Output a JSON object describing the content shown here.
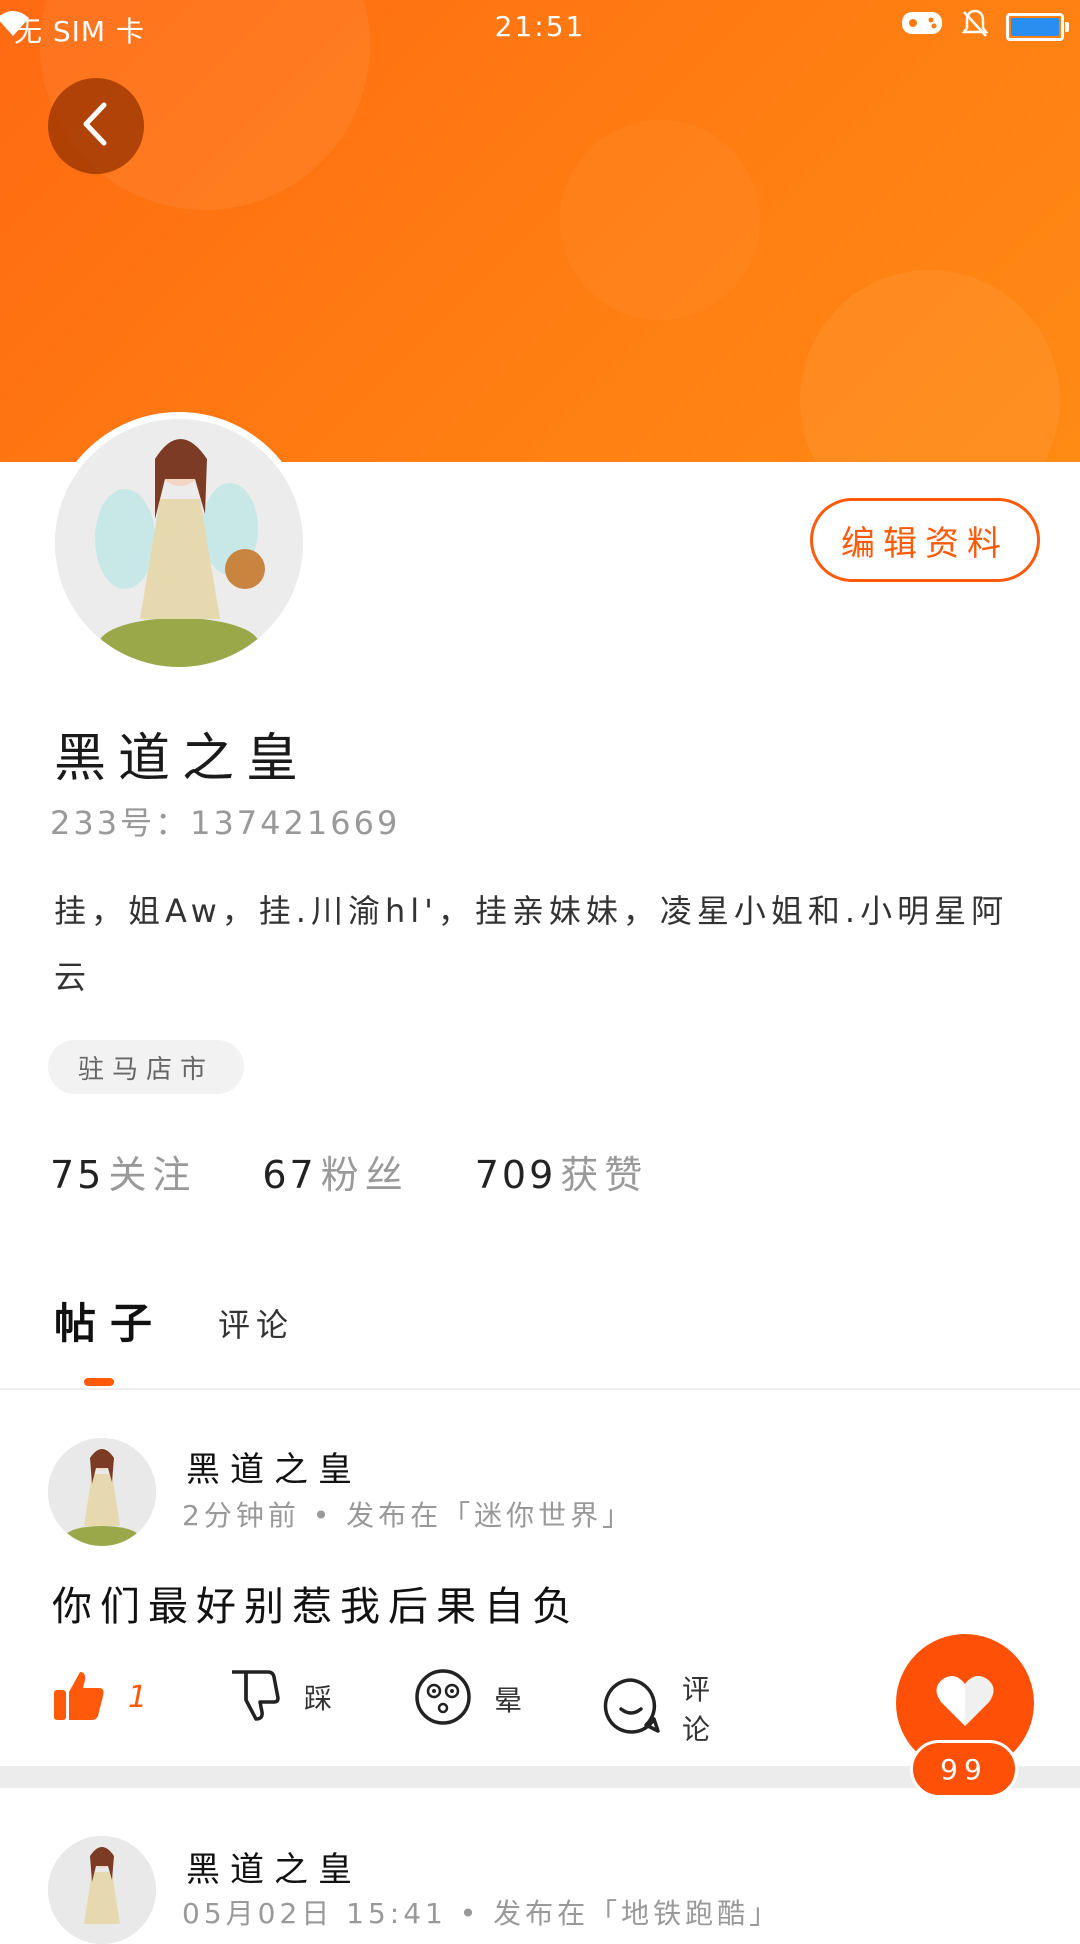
{
  "status_bar": {
    "carrier": "无 SIM 卡",
    "time": "21:51",
    "battery_color": "#2a8df0",
    "icons": [
      "wifi-icon",
      "game-icon",
      "mute-bell-icon",
      "battery-icon"
    ]
  },
  "header": {
    "back_icon": "chevron-left-icon",
    "banner_color": "#ff7a12"
  },
  "profile": {
    "edit_label": "编辑资料",
    "username": "黑道之皇",
    "uid": "233号：137421669",
    "bio": "挂，姐Aw，挂.川渝hl'，挂亲妹妹，凌星小姐和.小明星阿云",
    "location": "驻马店市",
    "stats": [
      {
        "num": "75",
        "label": "关注"
      },
      {
        "num": "67",
        "label": "粉丝"
      },
      {
        "num": "709",
        "label": "获赞"
      }
    ]
  },
  "tabs": [
    {
      "label": "帖子",
      "active": true
    },
    {
      "label": "评论",
      "active": false
    }
  ],
  "posts": [
    {
      "author": "黑道之皇",
      "meta": "2分钟前 • 发布在「迷你世界」",
      "content": "你们最好别惹我后果自负",
      "actions": {
        "like_count": "1",
        "dislike_label": "踩",
        "dizzy_label": "晕",
        "comment_label": "评论"
      }
    },
    {
      "author": "黑道之皇",
      "meta": "05月02日 15:41 • 发布在「地铁跑酷」"
    }
  ],
  "fab": {
    "icon": "heart-icon",
    "badge": "99",
    "color": "#ff5008"
  }
}
